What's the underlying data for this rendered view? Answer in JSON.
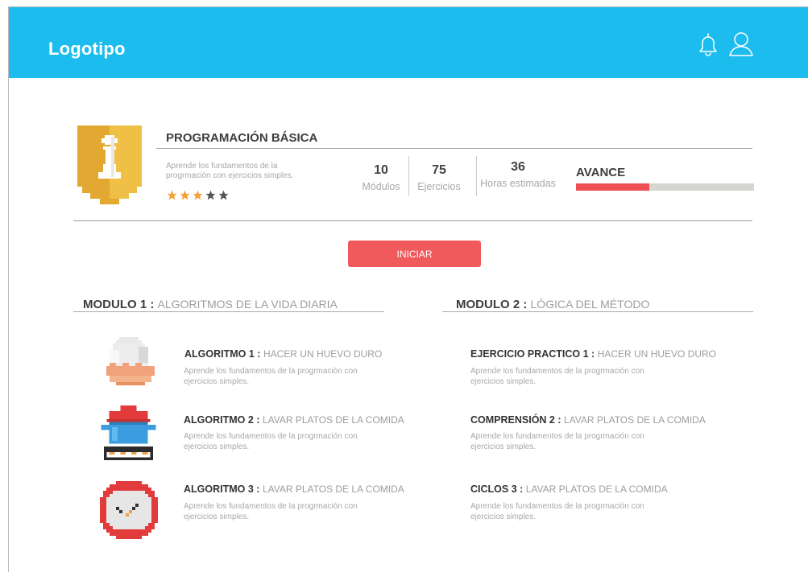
{
  "header": {
    "logo": "Logotipo",
    "icons": [
      "bell-icon",
      "user-icon"
    ],
    "color": "#1cbdee"
  },
  "course": {
    "title": "PROGRAMACIÓN BÁSICA",
    "description": "Aprende los fundamentos de la progrmación con ejercicios simples.",
    "rating": 3,
    "rating_max": 5,
    "stats": [
      {
        "value": "10",
        "label": "Módulos"
      },
      {
        "value": "75",
        "label": "Ejercicios"
      },
      {
        "value": "36",
        "label": "Horas estimadas"
      }
    ],
    "progress_label": "AVANCE",
    "progress_fraction": 0.41,
    "start_button": "INICIAR"
  },
  "modules": [
    {
      "prefix": "MODULO 1 :",
      "title": "ALGORITMOS DE LA VIDA DIARIA",
      "items": [
        {
          "prefix": "ALGORITMO 1 :",
          "title": "HACER UN HUEVO DURO",
          "desc": "Aprende los fundamentos de la progrmación con ejercicios simples.",
          "icon": "egg-icon"
        },
        {
          "prefix": "ALGORITMO 2 :",
          "title": "LAVAR PLATOS DE LA COMIDA",
          "desc": "Aprende los fundamentos de la progrmación con ejercicios simples.",
          "icon": "pot-icon"
        },
        {
          "prefix": "ALGORITMO 3 :",
          "title": "LAVAR PLATOS DE LA COMIDA",
          "desc": "Aprende los fundamentos de la progrmación con ejercicios simples.",
          "icon": "clock-icon"
        }
      ]
    },
    {
      "prefix": "MODULO 2 :",
      "title": "LÓGICA DEL MÉTODO",
      "items": [
        {
          "prefix": "EJERCICIO PRACTICO 1 :",
          "title": "HACER UN HUEVO DURO",
          "desc": "Aprende los fundamentos de la progrmación con ejercicios simples."
        },
        {
          "prefix": "COMPRENSIÓN 2 :",
          "title": "LAVAR PLATOS DE LA COMIDA",
          "desc": "Aprende los fundamentos de la progrmación con ejercicios simples."
        },
        {
          "prefix": "CICLOS 3 :",
          "title": "LAVAR PLATOS DE LA COMIDA",
          "desc": "Aprende los fundamentos de la progrmación con ejercicios simples."
        }
      ]
    }
  ],
  "colors": {
    "accent": "#f05a5c",
    "progress_track": "#d5d5d2",
    "star_active": "#f7a03a",
    "star_inactive": "#555555",
    "badge": "#e2a832"
  }
}
